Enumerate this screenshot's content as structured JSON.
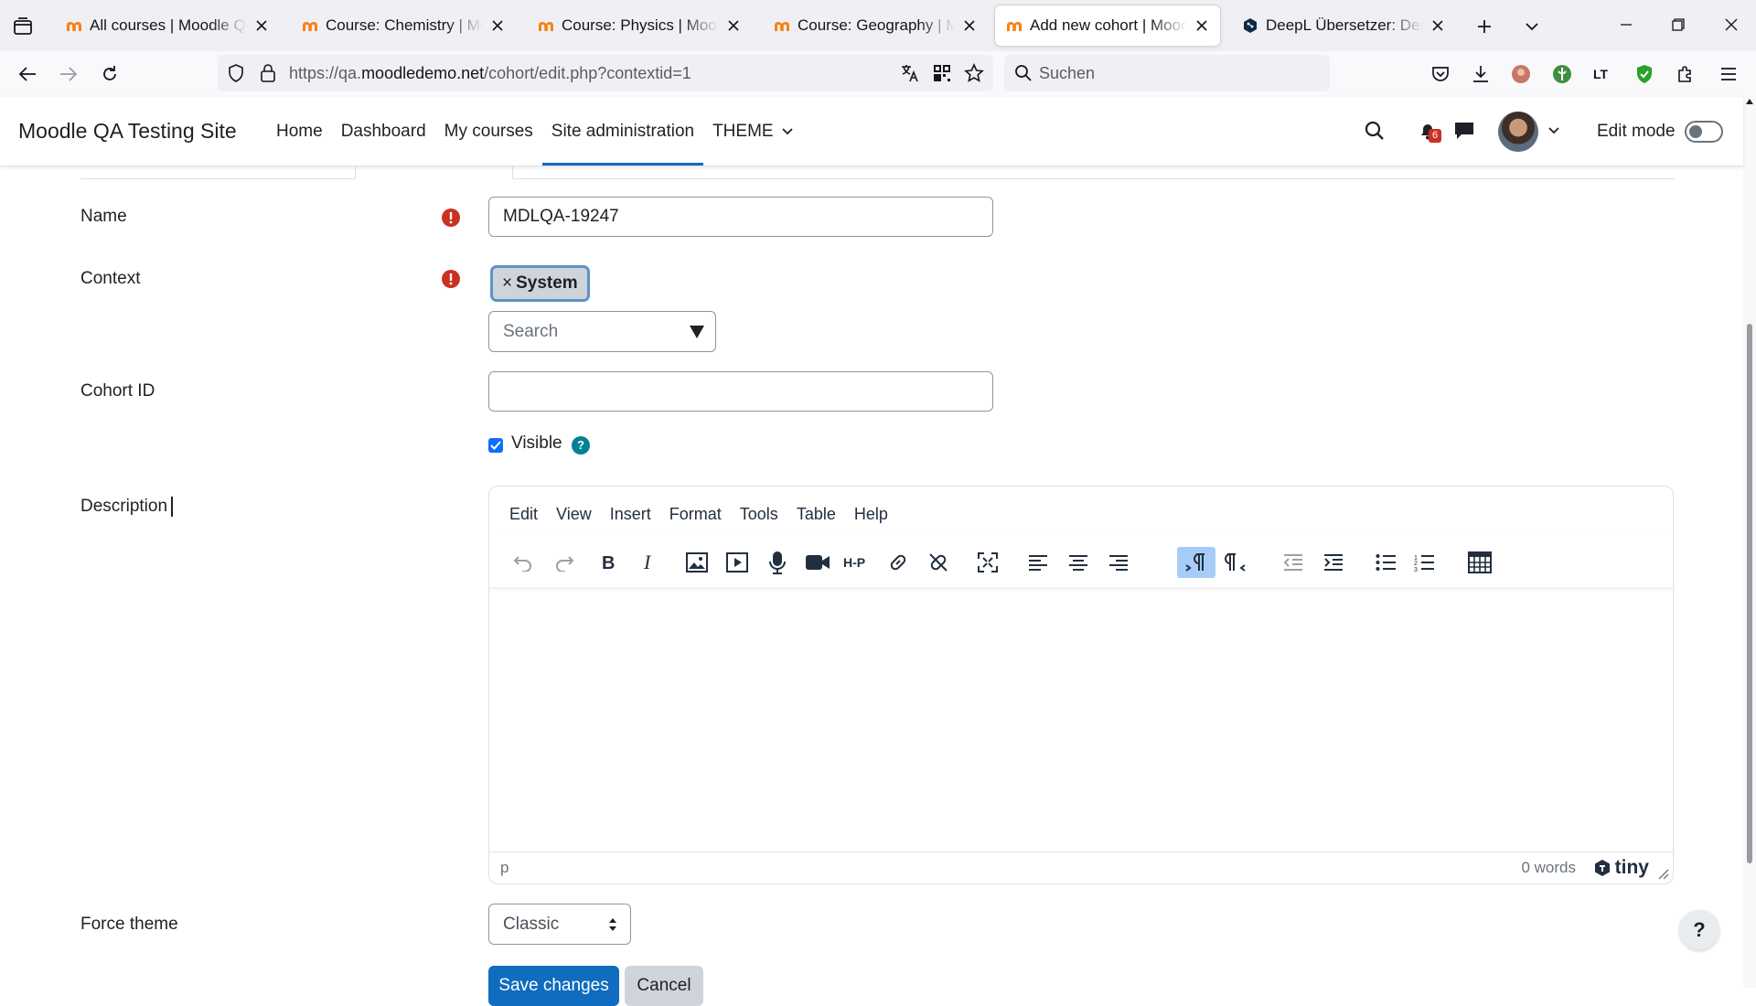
{
  "browser": {
    "tabs": [
      {
        "title": "All courses | Moodle QA Testing Site",
        "favicon": "moodle-icon",
        "active": false
      },
      {
        "title": "Course: Chemistry | Moodle QA Testing Site",
        "favicon": "moodle-icon",
        "active": false
      },
      {
        "title": "Course: Physics | Moodle QA Testing Site",
        "favicon": "moodle-icon",
        "active": false
      },
      {
        "title": "Course: Geography | Moodle QA Testing Site",
        "favicon": "moodle-icon",
        "active": false
      },
      {
        "title": "Add new cohort | Moodle QA Testing Site",
        "favicon": "moodle-icon",
        "active": true
      },
      {
        "title": "DeepL Übersetzer: Der präziseste Übersetzer",
        "favicon": "deepl-icon",
        "active": false
      }
    ],
    "url_prefix": "https://qa.",
    "url_domain": "moodledemo.net",
    "url_path": "/cohort/edit.php?contextid=1",
    "search_placeholder": "Suchen"
  },
  "header": {
    "site_name": "Moodle QA Testing Site",
    "nav": [
      {
        "label": "Home",
        "active": false
      },
      {
        "label": "Dashboard",
        "active": false
      },
      {
        "label": "My courses",
        "active": false
      },
      {
        "label": "Site administration",
        "active": true
      },
      {
        "label": "THEME",
        "active": false
      }
    ],
    "notification_count": "6",
    "edit_mode_label": "Edit mode",
    "edit_mode_on": false
  },
  "form": {
    "name_label": "Name",
    "name_value": "MDLQA-19247",
    "context_label": "Context",
    "context_chip_remove": "×",
    "context_chip": "System",
    "context_search_placeholder": "Search",
    "cohort_id_label": "Cohort ID",
    "cohort_id_value": "",
    "visible_label": "Visible",
    "visible_checked": true,
    "help_symbol": "?",
    "description_label": "Description",
    "editor": {
      "menu": [
        "Edit",
        "View",
        "Insert",
        "Format",
        "Tools",
        "Table",
        "Help"
      ],
      "status_path": "p",
      "word_count": "0 words",
      "brand": "tiny"
    },
    "force_theme_label": "Force theme",
    "force_theme_value": "Classic",
    "save_button": "Save changes",
    "cancel_button": "Cancel"
  },
  "floating_help": "?",
  "colors": {
    "primary": "#0f6cbf",
    "required": "#ca3120",
    "help": "#008196",
    "checkbox": "#0d6efd"
  }
}
